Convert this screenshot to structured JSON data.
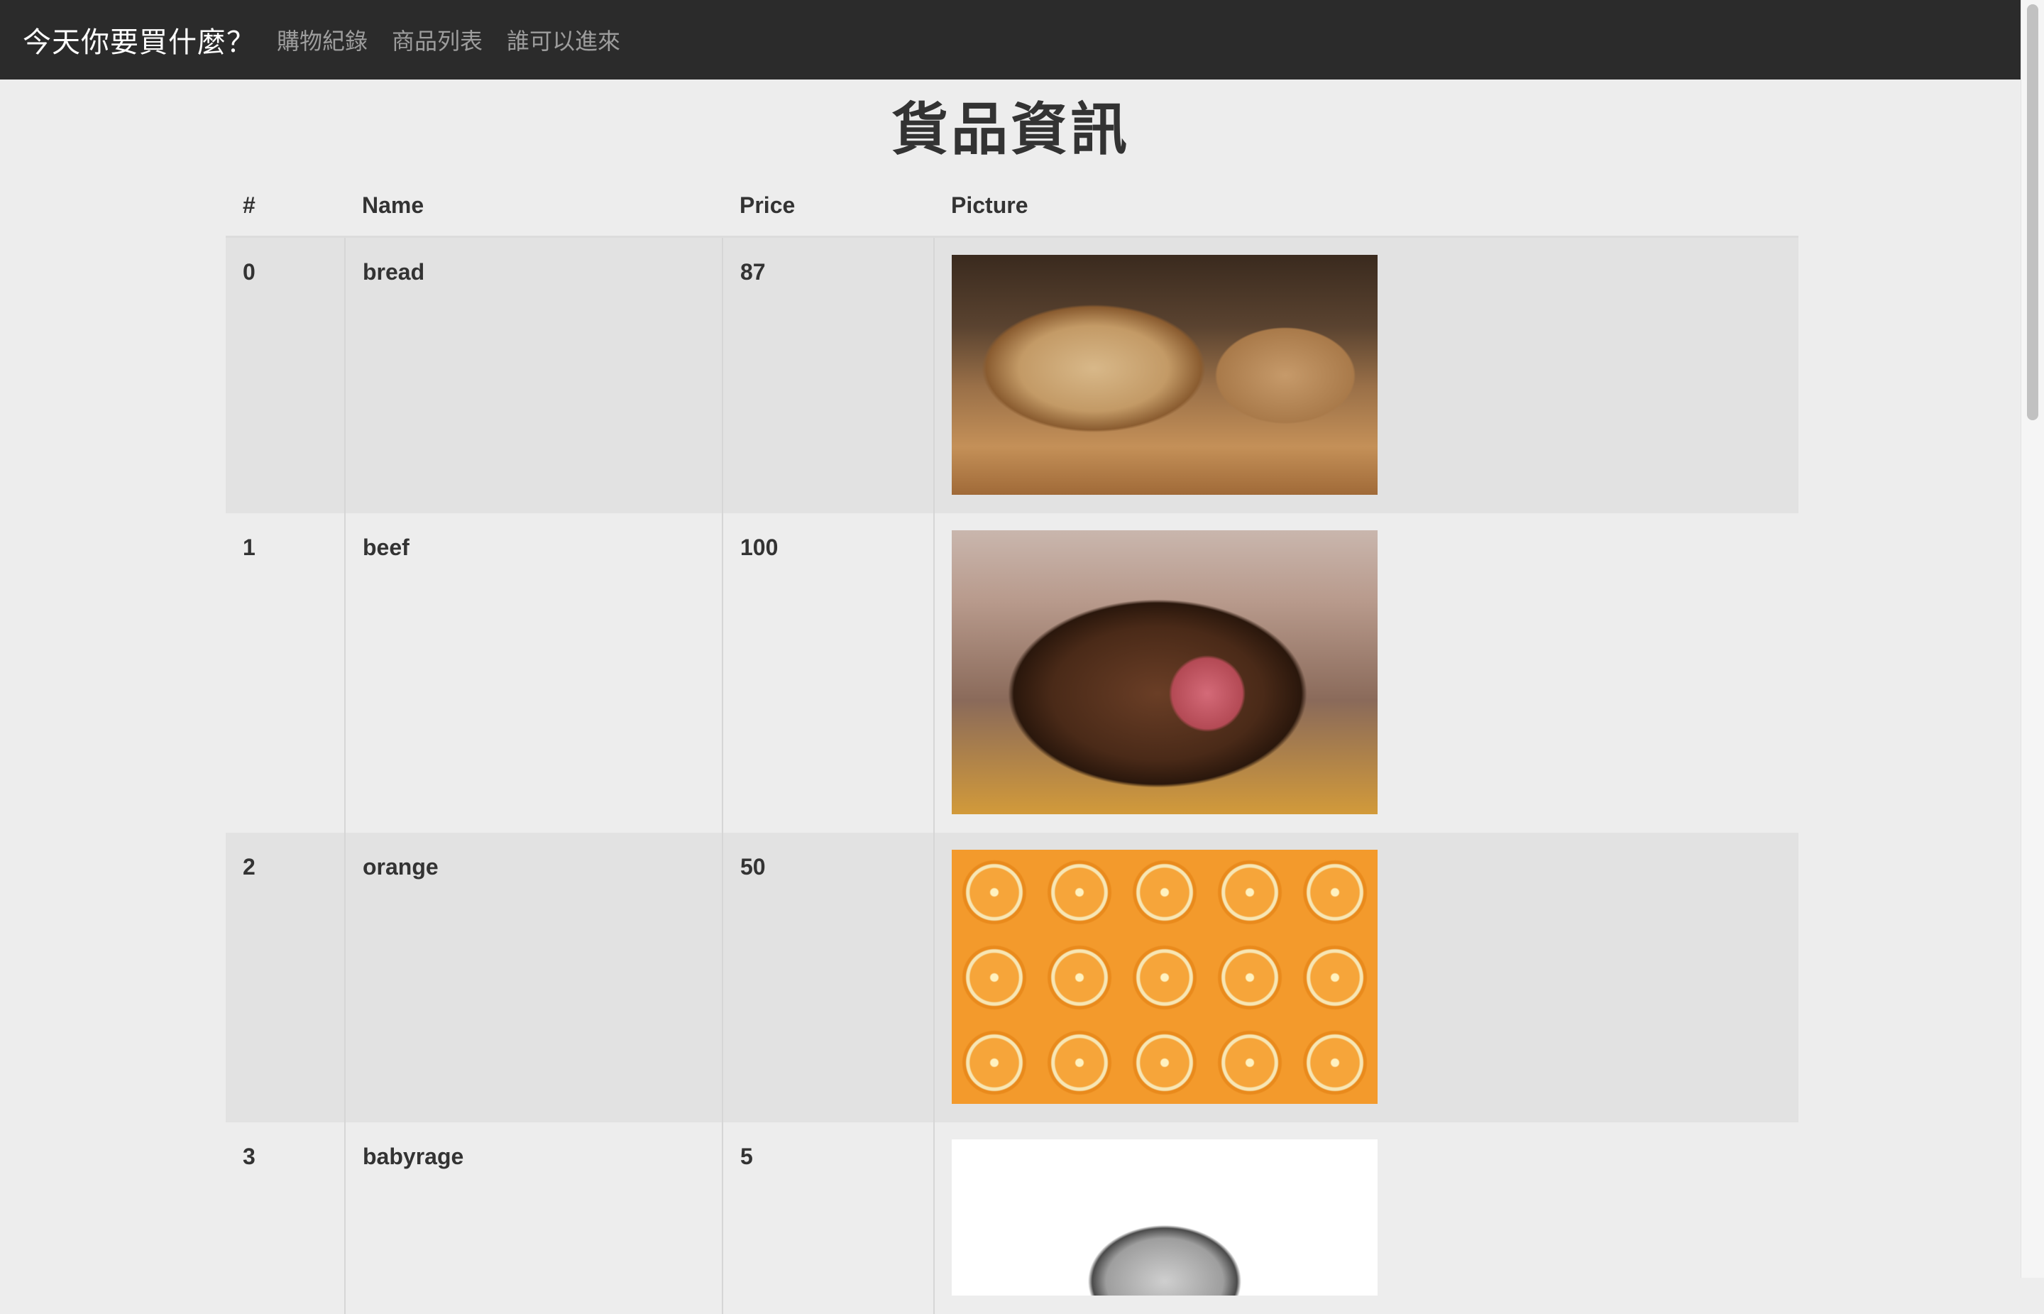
{
  "navbar": {
    "brand": "今天你要買什麼？",
    "links": [
      {
        "label": "購物紀錄"
      },
      {
        "label": "商品列表"
      },
      {
        "label": "誰可以進來"
      }
    ]
  },
  "page": {
    "title": "貨品資訊"
  },
  "table": {
    "headers": [
      "#",
      "Name",
      "Price",
      "Picture"
    ],
    "rows": [
      {
        "index": "0",
        "name": "bread",
        "price": "87",
        "picture": "bread-photo"
      },
      {
        "index": "1",
        "name": "beef",
        "price": "100",
        "picture": "roast-beef-photo"
      },
      {
        "index": "2",
        "name": "orange",
        "price": "50",
        "picture": "orange-slices-photo"
      },
      {
        "index": "3",
        "name": "babyrage",
        "price": "5",
        "picture": "baby-face-photo"
      }
    ]
  },
  "colors": {
    "navbar_bg": "#2b2b2b",
    "brand_text": "#ffffff",
    "nav_link_text": "#9d9d9d",
    "page_bg": "#ededed",
    "striped_row_bg": "#e2e2e2"
  }
}
